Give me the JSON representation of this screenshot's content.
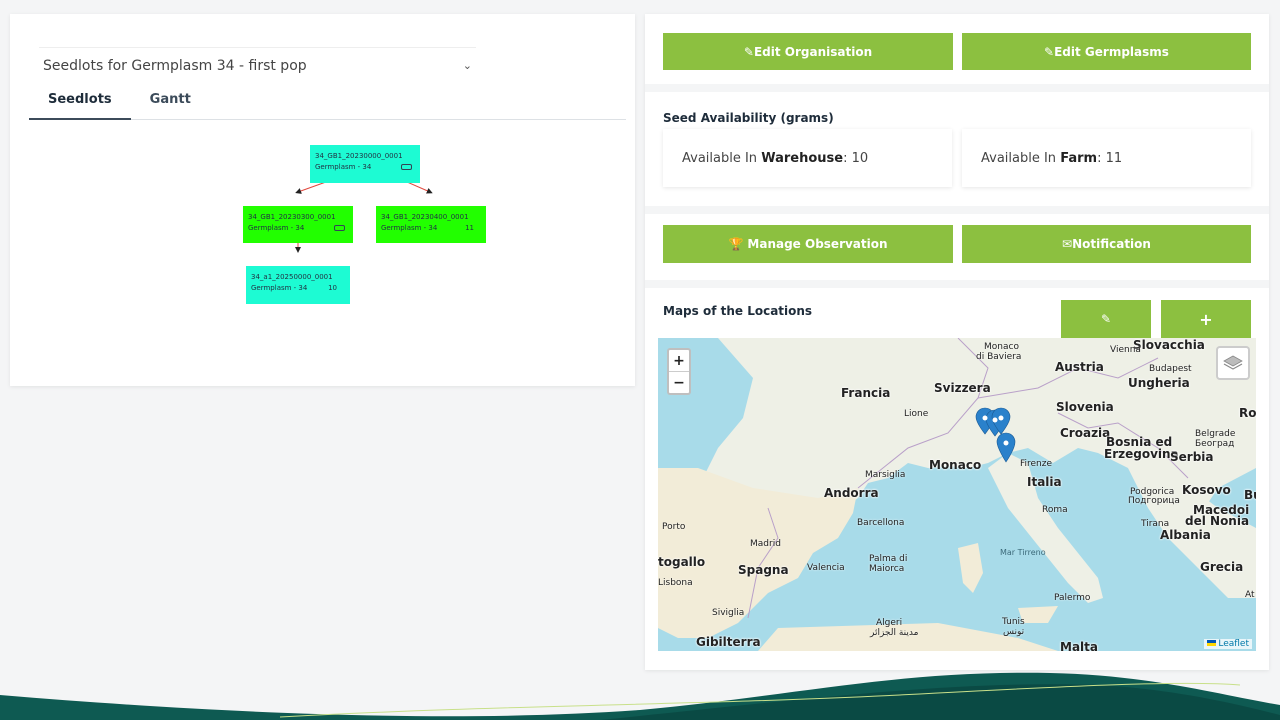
{
  "left": {
    "select_value": "Seedlots for Germplasm 34 - first pop",
    "tabs": [
      {
        "label": "Seedlots"
      },
      {
        "label": "Gantt"
      }
    ],
    "nodes": [
      {
        "id": "34_GB1_20230000_0001",
        "sub": "Germplasm - 34",
        "value": "",
        "color": "#1dfbd3"
      },
      {
        "id": "34_GB1_20230300_0001",
        "sub": "Germplasm - 34",
        "value": "",
        "color": "#22ff00"
      },
      {
        "id": "34_GB1_20230400_0001",
        "sub": "Germplasm - 34",
        "value": "11",
        "color": "#22ff00"
      },
      {
        "id": "34_a1_20250000_0001",
        "sub": "Germplasm - 34",
        "value": "10",
        "color": "#1dfbd3"
      }
    ]
  },
  "right": {
    "edit_org_label": "Edit Organisation",
    "edit_germ_label": "Edit Germplasms",
    "seed_title": "Seed Availability (grams)",
    "warehouse": {
      "prefix": "Available In",
      "place": "Warehouse",
      "value": "10"
    },
    "farm": {
      "prefix": "Available In",
      "place": "Farm",
      "value": "11"
    },
    "manage_obs_label": "Manage Observation",
    "notification_label": "Notification",
    "maps_title": "Maps of the Locations",
    "map": {
      "zoom_in": "+",
      "zoom_out": "−",
      "attribution": "Leaflet",
      "labels": {
        "francia": "Francia",
        "svizzera": "Svizzera",
        "austria": "Austria",
        "ungheria": "Ungheria",
        "slovenia": "Slovenia",
        "croazia": "Croazia",
        "bosnia": "Bosnia ed",
        "erzegovina": "Erzegovina",
        "serbia": "Serbia",
        "monaco_baviera": "Monaco",
        "di_baviera": "di Baviera",
        "vienna": "Vienna",
        "budapest": "Budapest",
        "lione": "Lione",
        "monaco": "Monaco",
        "marsiglia": "Marsiglia",
        "firenze": "Firenze",
        "italia": "Italia",
        "andorra": "Andorra",
        "roma": "Roma",
        "barcellona": "Barcellona",
        "porto": "Porto",
        "madrid": "Madrid",
        "spagna": "Spagna",
        "valencia": "Valencia",
        "palma": "Palma di",
        "maiorca": "Maiorca",
        "lisbona": "Lisbona",
        "portogallo": "togallo",
        "siviglia": "Siviglia",
        "gibilterra": "Gibilterra",
        "algeri": "Algeri",
        "algeri_ar": "مدينة الجزائر",
        "tunis": "Tunis",
        "tunis_ar": "تونس",
        "palermo": "Palermo",
        "malta": "Malta",
        "grecia": "Grecia",
        "albania": "Albania",
        "tirana": "Tirana",
        "kosovo": "Kosovo",
        "macedonia": "Macedoi",
        "del_nonia": "del Nonia",
        "podgorica": "Podgorica",
        "podgorica_cy": "Подгорица",
        "belgrade": "Belgrade",
        "belgrade_cy": "Београд",
        "mar_tirreno": "Mar Tirreno",
        "slovacchia": "Slovacchia",
        "ro": "Ro",
        "bu": "Bu",
        "at": "At"
      }
    }
  },
  "colors": {
    "green": "#8cc040",
    "teal_node": "#1dfbd3",
    "green_node": "#22ff00",
    "dark": "#1e2c3a"
  }
}
